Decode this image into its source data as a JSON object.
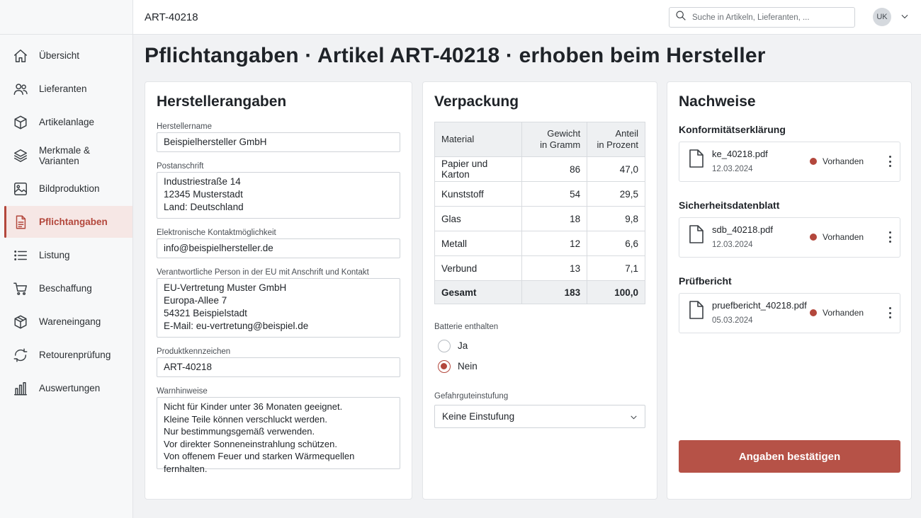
{
  "header": {
    "breadcrumb": "ART-40218",
    "search_placeholder": "Suche in Artikeln, Lieferanten, ...",
    "avatar_initials": "UK"
  },
  "page_title": "Pflichtangaben · Artikel ART-40218 · erhoben beim Hersteller",
  "sidebar": {
    "items": [
      {
        "label": "Übersicht",
        "icon": "home-icon"
      },
      {
        "label": "Lieferanten",
        "icon": "users-icon"
      },
      {
        "label": "Artikelanlage",
        "icon": "box-icon"
      },
      {
        "label": "Merkmale & Varianten",
        "icon": "layers-icon"
      },
      {
        "label": "Bildproduktion",
        "icon": "image-icon"
      },
      {
        "label": "Pflichtangaben",
        "icon": "document-icon",
        "active": true
      },
      {
        "label": "Listung",
        "icon": "list-icon"
      },
      {
        "label": "Beschaffung",
        "icon": "cart-icon"
      },
      {
        "label": "Wareneingang",
        "icon": "package-icon"
      },
      {
        "label": "Retourenprüfung",
        "icon": "refresh-icon"
      },
      {
        "label": "Auswertungen",
        "icon": "bar-chart-icon"
      }
    ]
  },
  "hersteller": {
    "title": "Herstellerangaben",
    "fields": [
      {
        "label": "Herstellername",
        "value": "Beispielhersteller GmbH"
      },
      {
        "label": "Postanschrift",
        "value": "Industriestraße 14\n12345 Musterstadt\nLand: Deutschland"
      },
      {
        "label": "Elektronische Kontaktmöglichkeit",
        "value": "info@beispielhersteller.de"
      },
      {
        "label": "Verantwortliche Person in der EU mit Anschrift und Kontakt",
        "value": "EU-Vertretung Muster GmbH\nEuropa-Allee 7\n54321 Beispielstadt\nE-Mail: eu-vertretung@beispiel.de"
      },
      {
        "label": "Produktkennzeichen",
        "value": "ART-40218"
      },
      {
        "label": "Warnhinweise",
        "value": "Nicht für Kinder unter 36 Monaten geeignet.\nKleine Teile können verschluckt werden.\nNur bestimmungsgemäß verwenden.\nVor direkter Sonneneinstrahlung schützen.\nVon offenem Feuer und starken Wärmequellen fernhalten."
      }
    ]
  },
  "verpackung": {
    "title": "Verpackung",
    "columns": [
      "Material",
      "Gewicht\nin Gramm",
      "Anteil\nin Prozent"
    ],
    "rows": [
      [
        "Papier und Karton",
        "86",
        "47,0"
      ],
      [
        "Kunststoff",
        "54",
        "29,5"
      ],
      [
        "Glas",
        "18",
        "9,8"
      ],
      [
        "Metall",
        "12",
        "6,6"
      ],
      [
        "Verbund",
        "13",
        "7,1"
      ]
    ],
    "total": [
      "Gesamt",
      "183",
      "100,0"
    ],
    "battery_label": "Batterie enthalten",
    "battery_options": [
      {
        "label": "Ja",
        "selected": false
      },
      {
        "label": "Nein",
        "selected": true
      }
    ],
    "hazard_label": "Gefahrguteinstufung",
    "hazard_value": "Keine Einstufung"
  },
  "nachweise": {
    "title": "Nachweise",
    "groups": [
      {
        "heading": "Konformitätserklärung",
        "file": "ke_40218.pdf",
        "date": "12.03.2024",
        "status": "Vorhanden"
      },
      {
        "heading": "Sicherheitsdatenblatt",
        "file": "sdb_40218.pdf",
        "date": "12.03.2024",
        "status": "Vorhanden"
      },
      {
        "heading": "Prüfbericht",
        "file": "pruefbericht_40218.pdf",
        "date": "05.03.2024",
        "status": "Vorhanden"
      }
    ],
    "confirm_label": "Angaben bestätigen"
  },
  "colors": {
    "accent": "#b3473c",
    "button": "#b65247",
    "active_bg": "#f6e7e5"
  }
}
